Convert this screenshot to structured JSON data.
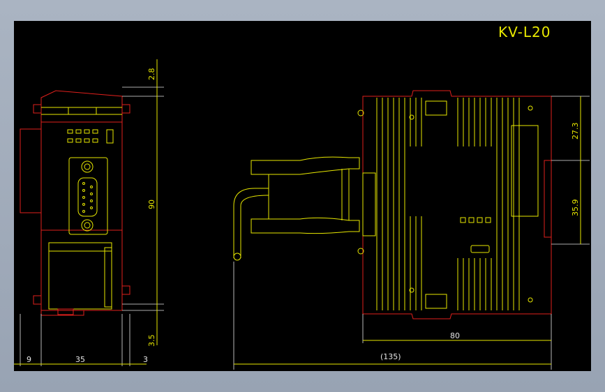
{
  "drawing": {
    "title": "KV-L20",
    "dimensions": {
      "top_offset": "2.8",
      "height": "90",
      "bottom_offset": "3.5",
      "left_margin": "9",
      "width": "35",
      "right_margin": "3",
      "upper_section": "27.3",
      "lower_section": "35.9",
      "depth": "80",
      "overall_depth": "(135)"
    },
    "colors": {
      "background": "#000000",
      "outline": "#e0201c",
      "detail": "#e8e800",
      "dimension_lines": "#e6e6e6"
    }
  }
}
